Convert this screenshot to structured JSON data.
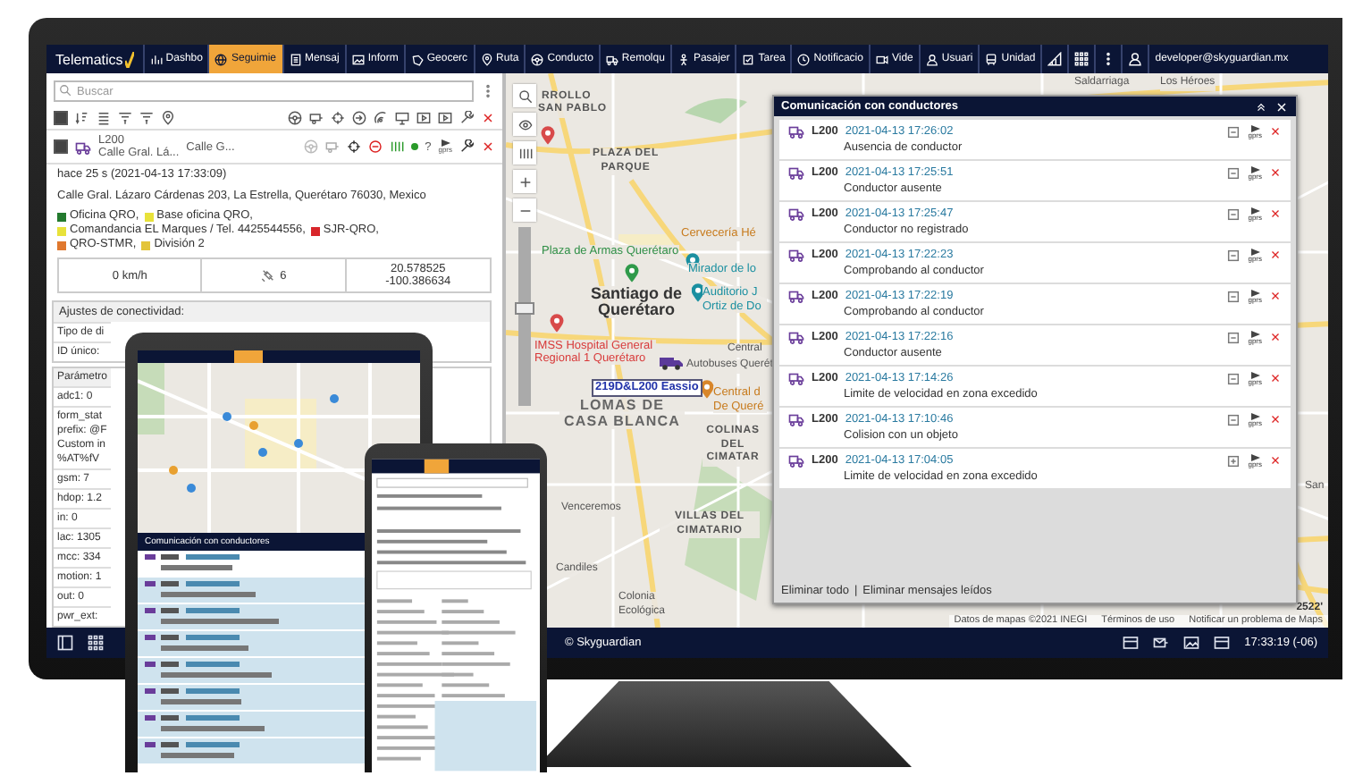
{
  "nav": {
    "logo": "Telematics",
    "items": [
      {
        "label": "Dashbo",
        "selected": false
      },
      {
        "label": "Seguimie",
        "selected": true
      },
      {
        "label": "Mensaj",
        "selected": false
      },
      {
        "label": "Inform",
        "selected": false
      },
      {
        "label": "Geocerc",
        "selected": false
      },
      {
        "label": "Ruta",
        "selected": false
      },
      {
        "label": "Conducto",
        "selected": false
      },
      {
        "label": "Remolqu",
        "selected": false
      },
      {
        "label": "Pasajer",
        "selected": false
      },
      {
        "label": "Tarea",
        "selected": false
      },
      {
        "label": "Notificacio",
        "selected": false
      },
      {
        "label": "Vide",
        "selected": false
      },
      {
        "label": "Usuari",
        "selected": false
      },
      {
        "label": "Unidad",
        "selected": false
      }
    ],
    "user": "developer@skyguardian.mx"
  },
  "left_panel": {
    "search": {
      "placeholder": "Buscar"
    },
    "select_all": {
      "checked": true
    },
    "unit": {
      "checked": true,
      "name": "L200",
      "address": "Calle Gral. Lá...",
      "column_3": "Calle G...",
      "status": "?",
      "command": "gprs"
    },
    "updated": "hace 25 s (2021-04-13 17:33:09)",
    "address": "Calle Gral. Lázaro Cárdenas 203, La Estrella, Querétaro 76030, Mexico",
    "geofences": [
      {
        "name": "Oficina QRO,",
        "color": "#237a2e"
      },
      {
        "name": "Base oficina QRO,",
        "color": "#e8e23a"
      },
      {
        "name": "Comandancia EL Marques / Tel. 4425544556,",
        "color": "#e8e23a"
      },
      {
        "name": "SJR-QRO,",
        "color": "#d8262b"
      },
      {
        "name": "QRO-STMR,",
        "color": "#e0782e"
      },
      {
        "name": "División 2",
        "color": "#e3c43a"
      }
    ],
    "speed": "0 km/h",
    "satellites": "6",
    "latitude": "20.578525",
    "longitude": "-100.386634",
    "connectivity": {
      "title": "Ajustes de conectividad:",
      "rows": [
        "Tipo de di",
        "ID único:"
      ]
    },
    "parameters": {
      "title": "Parámetro",
      "rows": [
        [
          "adc1: 0"
        ],
        [
          "form_stat",
          "prefix: @F",
          "Custom in",
          "%AT%fV"
        ],
        [
          "gsm: 7"
        ],
        [
          "hdop: 1.2"
        ],
        [
          "in: 0"
        ],
        [
          "lac: 1305"
        ],
        [
          "mcc: 334"
        ],
        [
          "motion: 1"
        ],
        [
          "out: 0"
        ],
        [
          "pwr_ext:"
        ]
      ]
    }
  },
  "map": {
    "zoom": {
      "level": 0.55
    },
    "labels": [
      {
        "text": "RROLLO",
        "kind": "area"
      },
      {
        "text": "SAN PABLO",
        "kind": "area"
      },
      {
        "text": "PLAZA DEL PARQUE",
        "kind": "area"
      },
      {
        "text": "Cervecería Hé",
        "kind": "food"
      },
      {
        "text": "Plaza de Armas Querétaro",
        "kind": "park"
      },
      {
        "text": "Mirador de lo",
        "kind": "poi"
      },
      {
        "text": "Santiago de Querétaro",
        "kind": "city"
      },
      {
        "text": "Auditorio J Ortiz de Do",
        "kind": "poi"
      },
      {
        "text": "IMSS Hospital General Regional 1 Querétaro",
        "kind": "health"
      },
      {
        "text": "Central",
        "kind": "place"
      },
      {
        "text": "Autobuses Querét",
        "kind": "place"
      },
      {
        "text": "219D&L200 Eassio",
        "kind": "vehicle"
      },
      {
        "text": "LOMAS DE CASA BLANCA",
        "kind": "district"
      },
      {
        "text": "Central d De Queré",
        "kind": "food"
      },
      {
        "text": "COLINAS DEL CIMATAR",
        "kind": "area"
      },
      {
        "text": "Venceremos",
        "kind": "place"
      },
      {
        "text": "VILLAS DEL CIMATARIO",
        "kind": "area"
      },
      {
        "text": "Candiles",
        "kind": "place"
      },
      {
        "text": "Colonia Ecológica",
        "kind": "place"
      },
      {
        "text": "Saldarriaga",
        "kind": "place"
      },
      {
        "text": "Los Héroes",
        "kind": "place"
      },
      {
        "text": "San",
        "kind": "place"
      }
    ],
    "attribution": [
      "Datos de mapas ©2021 INEGI",
      "Términos de uso",
      "Notificar un problema de Maps"
    ],
    "scale": "2522'"
  },
  "messages_panel": {
    "title": "Comunicación con conductores",
    "messages": [
      {
        "unit": "L200",
        "time": "2021-04-13 17:26:02",
        "text": "Ausencia de conductor",
        "expanded": true,
        "command": "gprs"
      },
      {
        "unit": "L200",
        "time": "2021-04-13 17:25:51",
        "text": "Conductor ausente",
        "expanded": true,
        "command": "gprs"
      },
      {
        "unit": "L200",
        "time": "2021-04-13 17:25:47",
        "text": "Conductor no registrado",
        "expanded": true,
        "command": "gprs"
      },
      {
        "unit": "L200",
        "time": "2021-04-13 17:22:23",
        "text": "Comprobando al conductor",
        "expanded": true,
        "command": "gprs"
      },
      {
        "unit": "L200",
        "time": "2021-04-13 17:22:19",
        "text": "Comprobando al conductor",
        "expanded": true,
        "command": "gprs"
      },
      {
        "unit": "L200",
        "time": "2021-04-13 17:22:16",
        "text": "Conductor ausente",
        "expanded": true,
        "command": "gprs"
      },
      {
        "unit": "L200",
        "time": "2021-04-13 17:14:26",
        "text": "Limite de velocidad en zona excedido",
        "expanded": true,
        "command": "gprs"
      },
      {
        "unit": "L200",
        "time": "2021-04-13 17:10:46",
        "text": "Colision con un objeto",
        "expanded": true,
        "command": "gprs"
      },
      {
        "unit": "L200",
        "time": "2021-04-13 17:04:05",
        "text": "Limite de velocidad en zona excedido",
        "expanded": false,
        "command": "gprs"
      }
    ],
    "actions": [
      "Eliminar todo",
      "Eliminar mensajes leídos"
    ],
    "separator": "|"
  },
  "status_bar": {
    "copyright": "© Skyguardian",
    "time": "17:33:19 (-06)"
  },
  "tablet": {
    "panel_title": "Comunicación con conductores"
  }
}
